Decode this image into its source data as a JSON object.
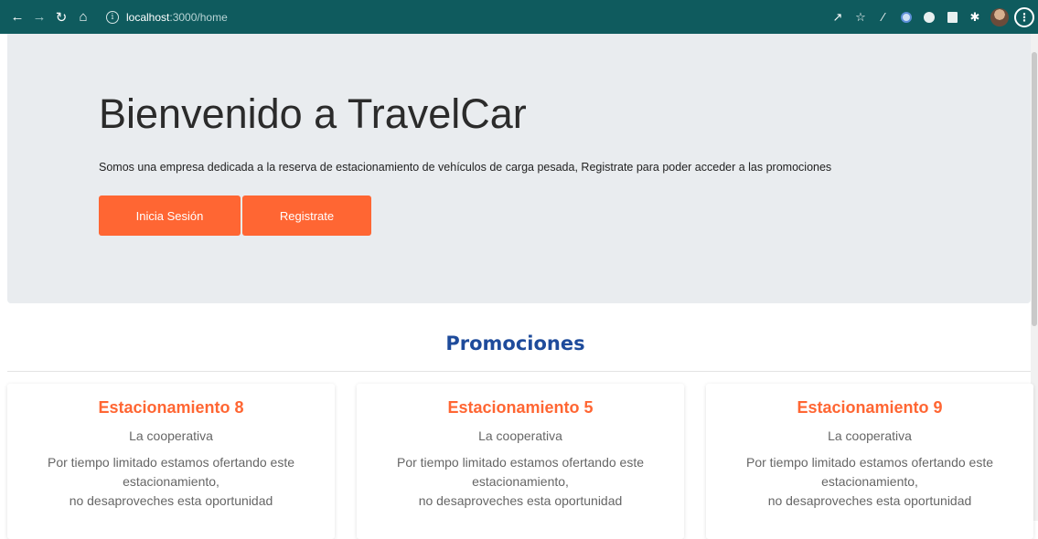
{
  "browser": {
    "url_host": "localhost",
    "url_path": ":3000/home",
    "icons": [
      "back-arrow-icon",
      "forward-arrow-icon",
      "reload-icon",
      "home-icon",
      "info-icon",
      "share-icon",
      "star-icon",
      "extensions-icon",
      "profile-avatar",
      "menu-icon"
    ]
  },
  "hero": {
    "title": "Bienvenido a TravelCar",
    "lead": "Somos una empresa dedicada a la reserva de estacionamiento de vehículos de carga pesada, Registrate para poder acceder a las promociones",
    "login_label": "Inicia Sesión",
    "register_label": "Registrate"
  },
  "promotions": {
    "title": "Promociones",
    "cards": [
      {
        "title": "Estacionamiento 8",
        "subtitle": "La cooperativa",
        "line1": "Por tiempo limitado estamos ofertando este",
        "line2": "estacionamiento,",
        "line3": "no desaproveches esta oportunidad"
      },
      {
        "title": "Estacionamiento 5",
        "subtitle": "La cooperativa",
        "line1": "Por tiempo limitado estamos ofertando este",
        "line2": "estacionamiento,",
        "line3": "no desaproveches esta oportunidad"
      },
      {
        "title": "Estacionamiento 9",
        "subtitle": "La cooperativa",
        "line1": "Por tiempo limitado estamos ofertando este",
        "line2": "estacionamiento,",
        "line3": "no desaproveches esta oportunidad"
      }
    ]
  },
  "colors": {
    "chrome_bg": "#0f5b5e",
    "hero_bg": "#e9ecef",
    "accent_orange": "#ff6633",
    "promo_title_blue": "#1e4b9b"
  }
}
